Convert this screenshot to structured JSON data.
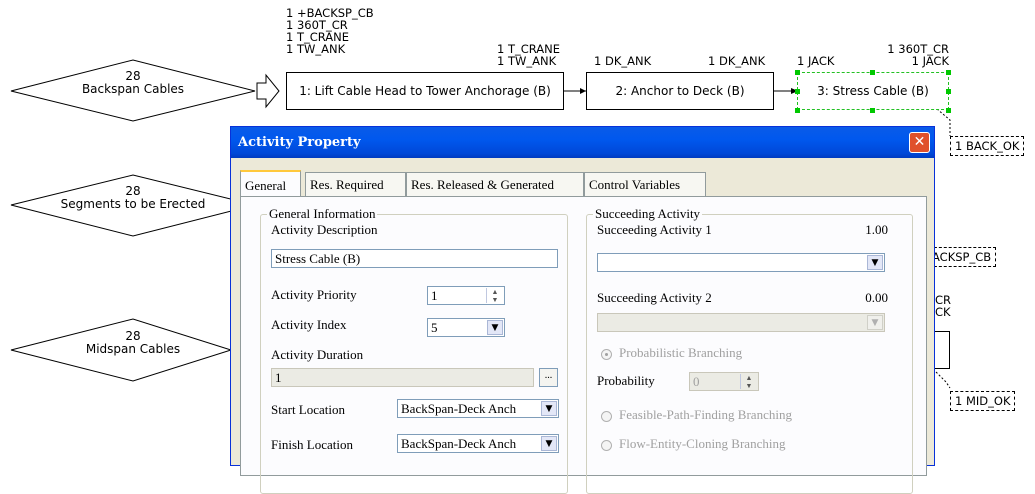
{
  "diagram": {
    "resources_top": {
      "left_stack": [
        "1 +BACKSP_CB",
        "1 360T_CR",
        "1 T_CRANE",
        "1 TW_ANK"
      ],
      "link1_top": [
        "1 T_CRANE",
        "1 TW_ANK"
      ],
      "link2_left": "1 DK_ANK",
      "link2_right": "1 DK_ANK",
      "link3_left": "1 JACK",
      "right_stack": [
        "1 360T_CR",
        "1 JACK"
      ]
    },
    "queues": [
      {
        "count": "28",
        "label": "Backspan Cables"
      },
      {
        "count": "28",
        "label": "Segments to be Erected"
      },
      {
        "count": "28",
        "label": "Midspan Cables"
      }
    ],
    "activities": [
      {
        "label": "1: Lift Cable Head to Tower Anchorage (B)"
      },
      {
        "label": "2: Anchor to Deck (B)"
      },
      {
        "label": "3: Stress Cable (B)"
      }
    ],
    "generated": {
      "back_ok": "1 BACK_OK",
      "backsp_cb": "ACKSP_CB",
      "partial_cr": "CR",
      "partial_ck": "CK",
      "mid_ok": "1 MID_OK"
    }
  },
  "dialog": {
    "title": "Activity Property",
    "close_glyph": "✕",
    "tabs": [
      "General",
      "Res. Required",
      "Res. Released & Generated",
      "Control Variables"
    ],
    "general_info": {
      "group_title": "General Information",
      "desc_label": "Activity Description",
      "desc_value": "Stress Cable (B)",
      "priority_label": "Activity Priority",
      "priority_value": "1",
      "index_label": "Activity Index",
      "index_value": "5",
      "duration_label": "Activity Duration",
      "duration_value": "1",
      "ellipsis": "...",
      "start_label": "Start Location",
      "start_value": "BackSpan-Deck Anch",
      "finish_label": "Finish Location",
      "finish_value": "BackSpan-Deck Anch"
    },
    "succeeding": {
      "group_title": "Succeeding Activity",
      "s1_label": "Succeeding Activity 1",
      "s1_prob": "1.00",
      "s1_value": "",
      "s2_label": "Succeeding Activity 2",
      "s2_prob": "0.00",
      "s2_value": "",
      "prob_branch": "Probabilistic Branching",
      "probability_label": "Probability",
      "probability_value": "0",
      "feasible_branch": "Feasible-Path-Finding Branching",
      "cloning_branch": "Flow-Entity-Cloning Branching"
    },
    "colors": {
      "titlebar": "#0058ee",
      "face": "#ece9d8",
      "close": "#e0512c"
    }
  }
}
